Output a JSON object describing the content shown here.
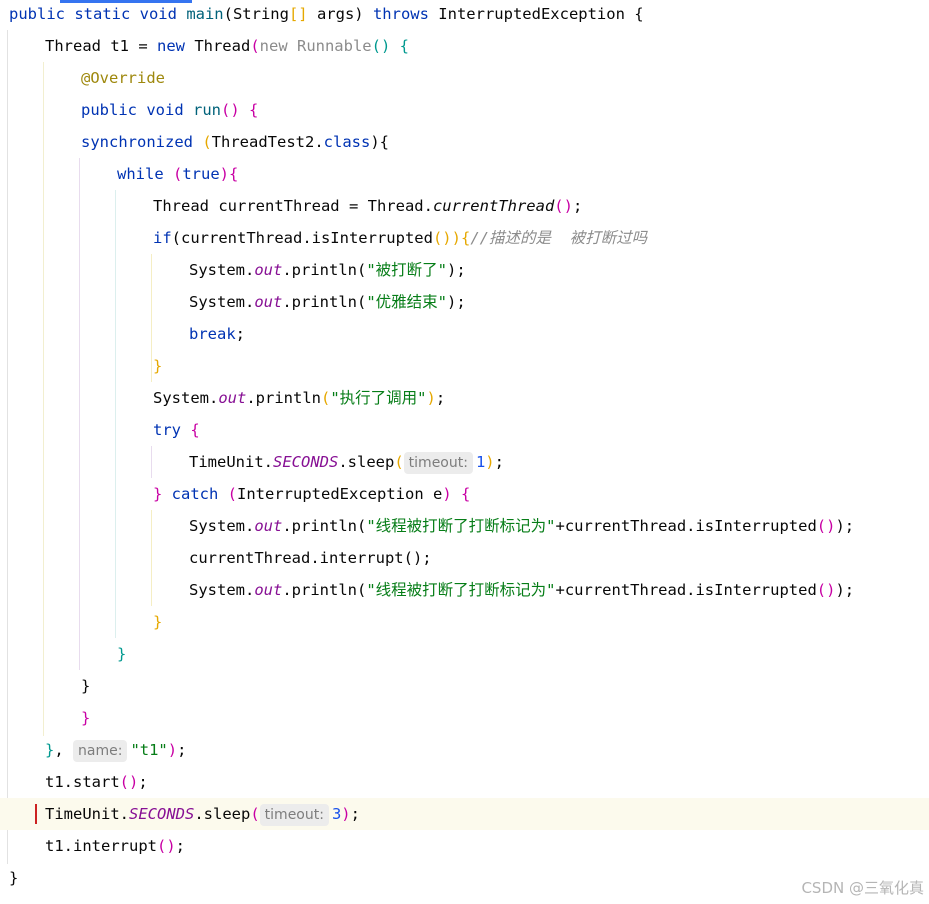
{
  "editor": {
    "lines": [
      {
        "indent": 0,
        "tokens": [
          {
            "t": "public static void ",
            "c": "kw"
          },
          {
            "t": "main",
            "c": "fn"
          },
          {
            "t": "(String"
          },
          {
            "t": "[]",
            "c": "p2"
          },
          {
            "t": " args) "
          },
          {
            "t": "throws ",
            "c": "kw"
          },
          {
            "t": "InterruptedException {"
          }
        ]
      },
      {
        "indent": 1,
        "tokens": [
          {
            "t": "Thread t1 = "
          },
          {
            "t": "new ",
            "c": "kw"
          },
          {
            "t": "Thread"
          },
          {
            "t": "(",
            "c": "p4"
          },
          {
            "t": "new ",
            "c": "grey"
          },
          {
            "t": "Runnable",
            "c": "grey"
          },
          {
            "t": "() {",
            "c": "p3"
          }
        ]
      },
      {
        "indent": 2,
        "tokens": [
          {
            "t": "@Override",
            "c": "ann"
          }
        ]
      },
      {
        "indent": 2,
        "tokens": [
          {
            "t": "public void ",
            "c": "kw"
          },
          {
            "t": "run",
            "c": "fn"
          },
          {
            "t": "() {",
            "c": "p4"
          }
        ]
      },
      {
        "indent": 2,
        "tokens": [
          {
            "t": "synchronized ",
            "c": "kw"
          },
          {
            "t": "(",
            "c": "p2"
          },
          {
            "t": "ThreadTest2."
          },
          {
            "t": "class",
            "c": "kw"
          },
          {
            "t": "){"
          }
        ]
      },
      {
        "indent": 3,
        "tokens": [
          {
            "t": "while ",
            "c": "kw"
          },
          {
            "t": "(",
            "c": "p4"
          },
          {
            "t": "true",
            "c": "kw"
          },
          {
            "t": "){",
            "c": "p4"
          }
        ]
      },
      {
        "indent": 4,
        "tokens": [
          {
            "t": "Thread currentThread = Thread."
          },
          {
            "t": "currentThread",
            "c": "ital"
          },
          {
            "t": "()",
            "c": "p4"
          },
          {
            "t": ";"
          }
        ]
      },
      {
        "indent": 4,
        "tokens": [
          {
            "t": "if",
            "c": "kw"
          },
          {
            "t": "(currentThread.isInterrupted"
          },
          {
            "t": "()",
            "c": "p2"
          },
          {
            "t": "){",
            "c": "p2"
          },
          {
            "t": "//描述的是  被打断过吗",
            "c": "com"
          }
        ]
      },
      {
        "indent": 5,
        "tokens": [
          {
            "t": "System."
          },
          {
            "t": "out",
            "c": "fld"
          },
          {
            "t": ".println("
          },
          {
            "t": "\"被打断了\"",
            "c": "str"
          },
          {
            "t": ");"
          }
        ]
      },
      {
        "indent": 5,
        "tokens": [
          {
            "t": "System."
          },
          {
            "t": "out",
            "c": "fld"
          },
          {
            "t": ".println("
          },
          {
            "t": "\"优雅结束\"",
            "c": "str"
          },
          {
            "t": ");"
          }
        ]
      },
      {
        "indent": 5,
        "tokens": [
          {
            "t": "break",
            "c": "kw"
          },
          {
            "t": ";"
          }
        ]
      },
      {
        "indent": 4,
        "tokens": [
          {
            "t": "}",
            "c": "p2"
          }
        ]
      },
      {
        "indent": 4,
        "tokens": [
          {
            "t": "System."
          },
          {
            "t": "out",
            "c": "fld"
          },
          {
            "t": ".println"
          },
          {
            "t": "(",
            "c": "p2"
          },
          {
            "t": "\"执行了调用\"",
            "c": "str"
          },
          {
            "t": ")",
            "c": "p2"
          },
          {
            "t": ";"
          }
        ]
      },
      {
        "indent": 4,
        "tokens": [
          {
            "t": "try ",
            "c": "kw"
          },
          {
            "t": "{",
            "c": "p4"
          }
        ]
      },
      {
        "indent": 5,
        "tokens": [
          {
            "t": "TimeUnit."
          },
          {
            "t": "SECONDS",
            "c": "fld"
          },
          {
            "t": ".sleep"
          },
          {
            "t": "(",
            "c": "p2"
          },
          {
            "h": "timeout:"
          },
          {
            "t": "1",
            "c": "num"
          },
          {
            "t": ")",
            "c": "p2"
          },
          {
            "t": ";"
          }
        ]
      },
      {
        "indent": 4,
        "tokens": [
          {
            "t": "} ",
            "c": "p4"
          },
          {
            "t": "catch ",
            "c": "kw"
          },
          {
            "t": "(",
            "c": "p4"
          },
          {
            "t": "InterruptedException e"
          },
          {
            "t": ") {",
            "c": "p4"
          }
        ]
      },
      {
        "indent": 5,
        "tokens": [
          {
            "t": "System."
          },
          {
            "t": "out",
            "c": "fld"
          },
          {
            "t": ".println("
          },
          {
            "t": "\"线程被打断了打断标记为\"",
            "c": "str"
          },
          {
            "t": "+currentThread.isInterrupted"
          },
          {
            "t": "()",
            "c": "p4"
          },
          {
            "t": ");"
          }
        ]
      },
      {
        "indent": 5,
        "tokens": [
          {
            "t": "currentThread.interrupt();"
          }
        ]
      },
      {
        "indent": 5,
        "tokens": [
          {
            "t": "System."
          },
          {
            "t": "out",
            "c": "fld"
          },
          {
            "t": ".println("
          },
          {
            "t": "\"线程被打断了打断标记为\"",
            "c": "str"
          },
          {
            "t": "+currentThread.isInterrupted"
          },
          {
            "t": "()",
            "c": "p4"
          },
          {
            "t": ");"
          }
        ]
      },
      {
        "indent": 4,
        "tokens": [
          {
            "t": "}",
            "c": "p2"
          }
        ]
      },
      {
        "indent": 3,
        "tokens": [
          {
            "t": "}",
            "c": "p3"
          }
        ]
      },
      {
        "indent": 2,
        "tokens": [
          {
            "t": "}"
          }
        ]
      },
      {
        "indent": 2,
        "tokens": [
          {
            "t": "}",
            "c": "p4"
          }
        ]
      },
      {
        "indent": 1,
        "tokens": [
          {
            "t": "}",
            "c": "p3"
          },
          {
            "t": ", "
          },
          {
            "h": "name:"
          },
          {
            "t": "\"t1\"",
            "c": "str"
          },
          {
            "t": ")",
            "c": "p4"
          },
          {
            "t": ";"
          }
        ]
      },
      {
        "indent": 1,
        "tokens": [
          {
            "t": "t1.start"
          },
          {
            "t": "()",
            "c": "p4"
          },
          {
            "t": ";"
          }
        ]
      },
      {
        "indent": 1,
        "current": true,
        "tokens": [
          {
            "t": "TimeUnit."
          },
          {
            "t": "SECONDS",
            "c": "fld"
          },
          {
            "t": ".sleep"
          },
          {
            "t": "(",
            "c": "p4"
          },
          {
            "h": "timeout:"
          },
          {
            "t": "3",
            "c": "num"
          },
          {
            "t": ")",
            "c": "p4"
          },
          {
            "t": ";"
          }
        ]
      },
      {
        "indent": 1,
        "tokens": [
          {
            "t": "t1.interrupt"
          },
          {
            "t": "()",
            "c": "p4"
          },
          {
            "t": ";"
          }
        ]
      },
      {
        "indent": 0,
        "tokens": [
          {
            "t": "}"
          }
        ]
      }
    ]
  },
  "colors": {
    "keyword": "#0033b3",
    "string": "#067d17",
    "number": "#1750eb",
    "field": "#871094",
    "annotation": "#9e880d",
    "comment": "#8c8c8c",
    "current_line": "#fcfaed"
  },
  "watermark": "CSDN @三氧化真"
}
